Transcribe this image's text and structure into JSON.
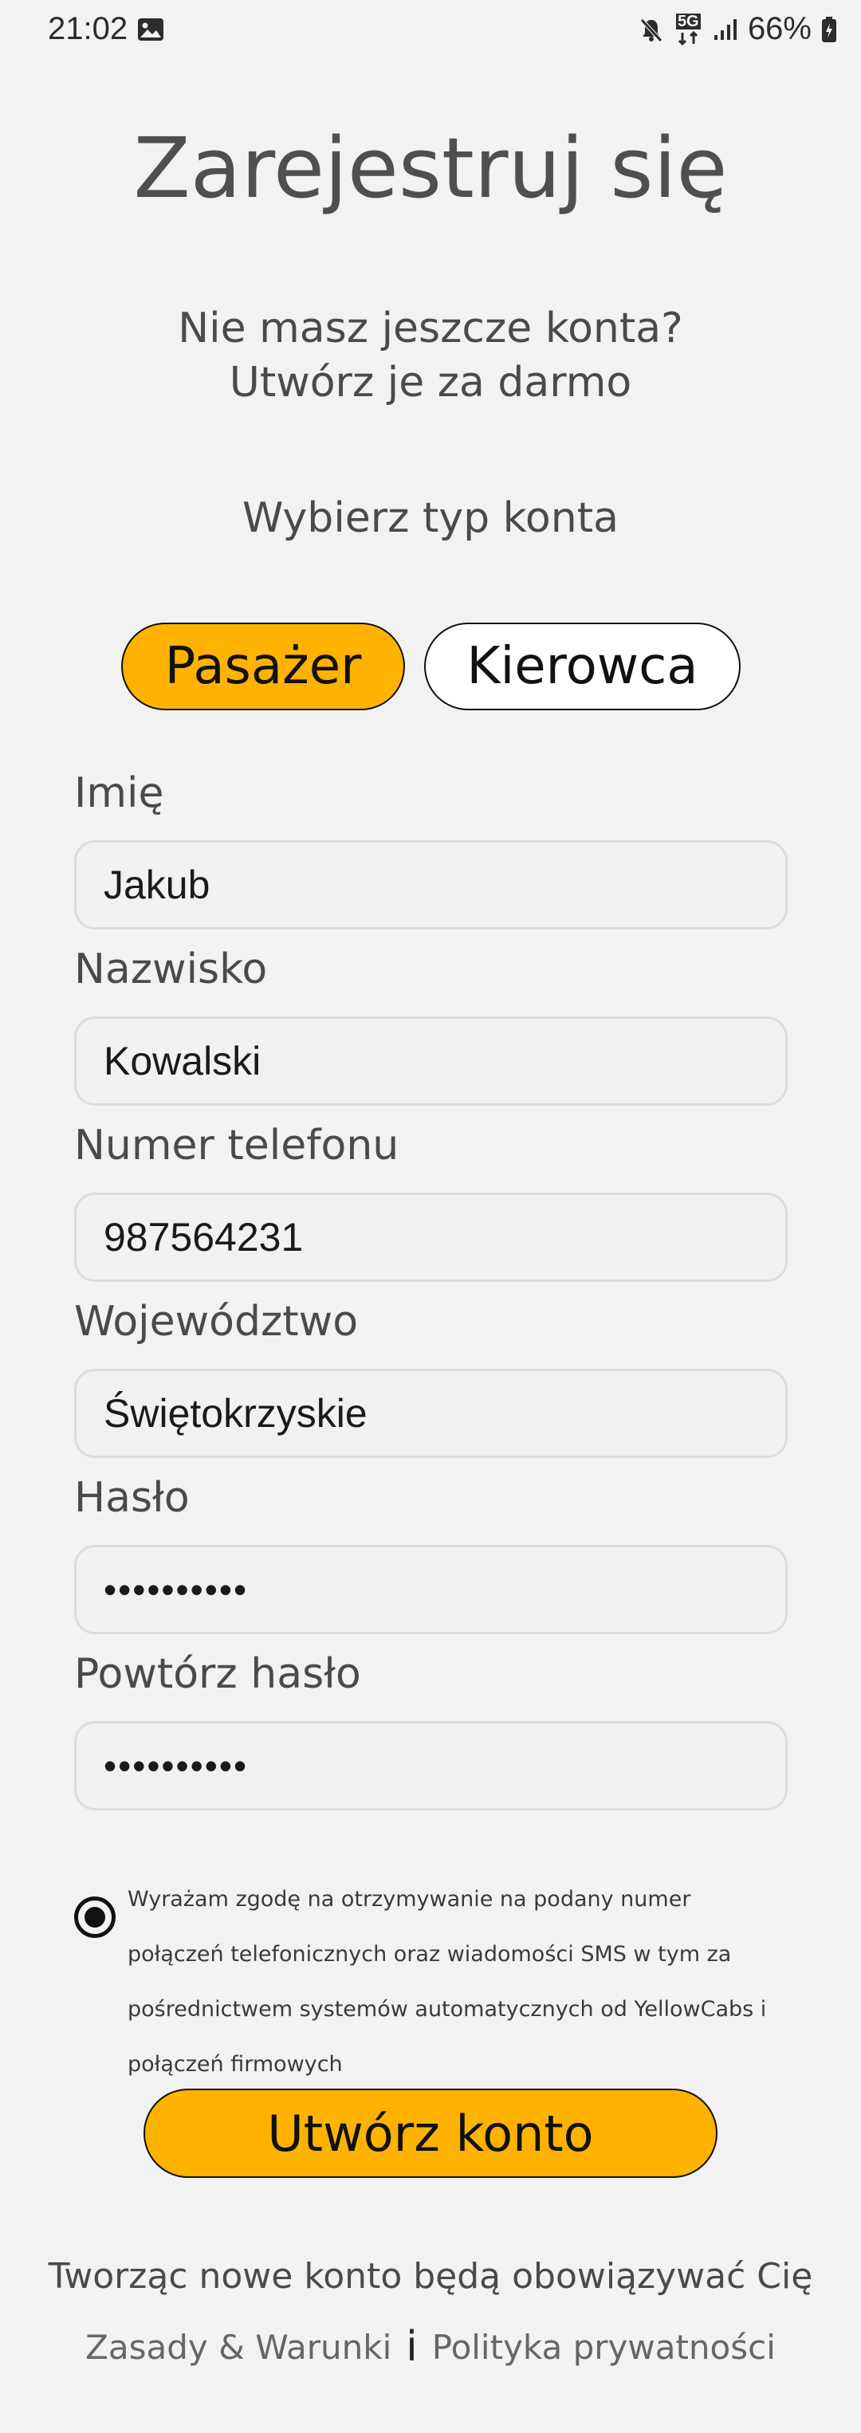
{
  "status_bar": {
    "time": "21:02",
    "network": "5G",
    "battery": "66%",
    "icons": [
      "gallery-icon",
      "mute-icon",
      "network-5g-icon",
      "signal-icon",
      "battery-icon"
    ]
  },
  "page": {
    "title": "Zarejestruj się",
    "subtitle_line1": "Nie masz jeszcze konta?",
    "subtitle_line2": "Utwórz je za darmo",
    "account_type_label": "Wybierz typ konta"
  },
  "account_types": {
    "passenger": "Pasażer",
    "driver": "Kierowca",
    "selected": "passenger"
  },
  "form": {
    "first_name": {
      "label": "Imię",
      "value": "Jakub"
    },
    "last_name": {
      "label": "Nazwisko",
      "value": "Kowalski"
    },
    "phone": {
      "label": "Numer telefonu",
      "value": "987564231"
    },
    "province": {
      "label": "Województwo",
      "value": "Świętokrzyskie"
    },
    "password": {
      "label": "Hasło",
      "value": "••••••••••"
    },
    "password_repeat": {
      "label": "Powtórz hasło",
      "value": "••••••••••"
    }
  },
  "consent": {
    "checked": true,
    "text": "Wyrażam zgodę na otrzymywanie na podany numer połączeń telefonicznych oraz wiadomości SMS w tym za pośrednictwem systemów automatycznych od YellowCabs i połączeń firmowych"
  },
  "actions": {
    "create_account": "Utwórz konto"
  },
  "footer": {
    "notice": "Tworząc nowe konto będą obowiązywać Cię",
    "terms_link": "Zasady & Warunki",
    "separator": "i",
    "privacy_link": "Polityka prywatności"
  },
  "colors": {
    "accent": "#ffb300",
    "background": "#f2f2f2",
    "field_background": "#f1f1f1",
    "field_border": "#dcdcdc"
  }
}
